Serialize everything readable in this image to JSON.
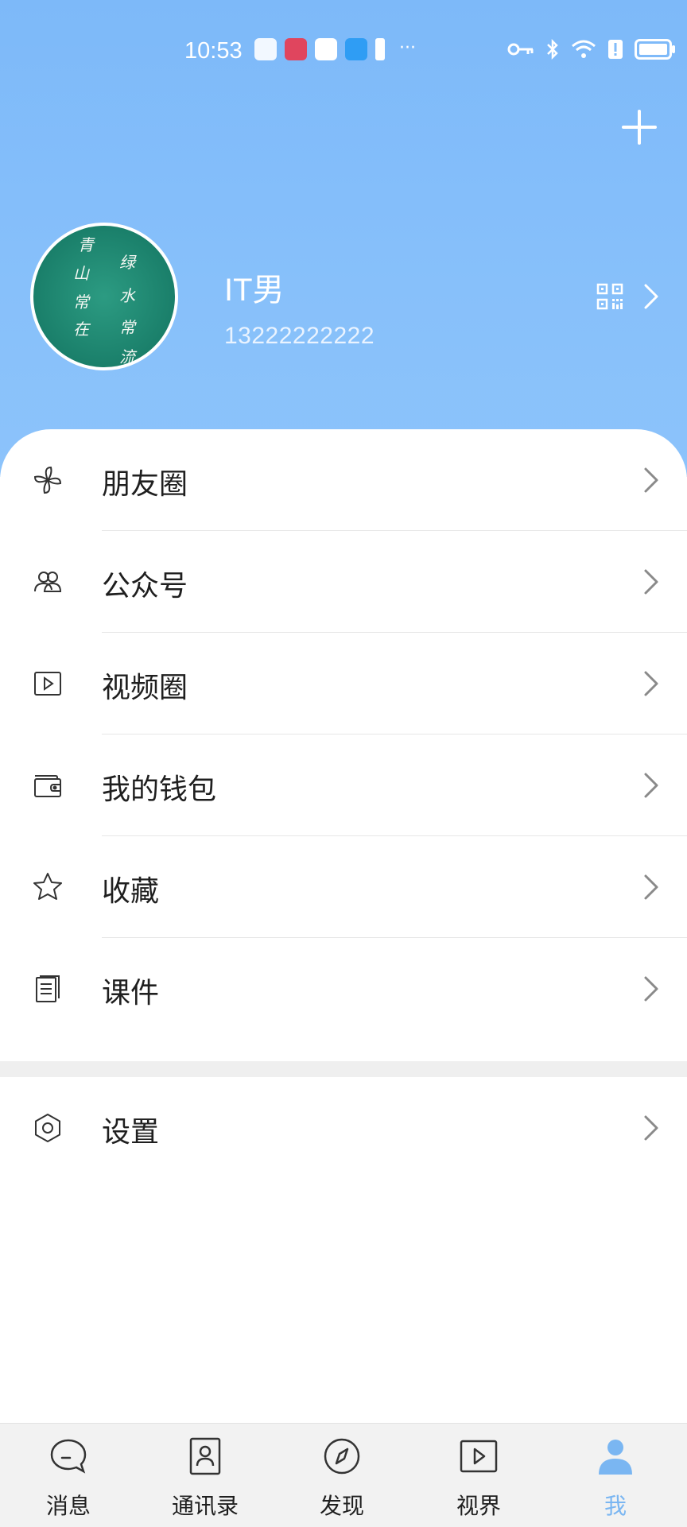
{
  "status_bar": {
    "time": "10:53",
    "more": "···",
    "icons_left": [
      "notification-app-icon",
      "book-app-icon",
      "globe-app-icon",
      "search-app-icon",
      "alert-icon"
    ],
    "icons_right": [
      "key-icon",
      "bluetooth-icon",
      "wifi-icon",
      "alert-icon",
      "battery-icon"
    ]
  },
  "header": {
    "add_icon": "plus-icon",
    "profile": {
      "name": "IT男",
      "phone": "13222222222",
      "avatar_text": [
        "青",
        "山",
        "常",
        "在",
        "绿",
        "水",
        "常",
        "流"
      ]
    },
    "qr_icon": "qr-code-icon"
  },
  "menu": {
    "items": [
      {
        "label": "朋友圈",
        "icon": "moments-icon"
      },
      {
        "label": "公众号",
        "icon": "official-accounts-icon"
      },
      {
        "label": "视频圈",
        "icon": "video-icon"
      },
      {
        "label": "我的钱包",
        "icon": "wallet-icon"
      },
      {
        "label": "收藏",
        "icon": "star-icon"
      },
      {
        "label": "课件",
        "icon": "document-icon"
      }
    ],
    "settings": {
      "label": "设置",
      "icon": "settings-icon"
    }
  },
  "bottom_nav": {
    "items": [
      {
        "label": "消息",
        "icon": "chat-icon"
      },
      {
        "label": "通讯录",
        "icon": "contacts-icon"
      },
      {
        "label": "发现",
        "icon": "compass-icon"
      },
      {
        "label": "视界",
        "icon": "video-icon"
      },
      {
        "label": "我",
        "icon": "user-icon",
        "active": true
      }
    ]
  },
  "colors": {
    "header_bg": "#82bcf9",
    "active_tab": "#7ab6f2",
    "avatar_bg": "#1a7f6a"
  }
}
